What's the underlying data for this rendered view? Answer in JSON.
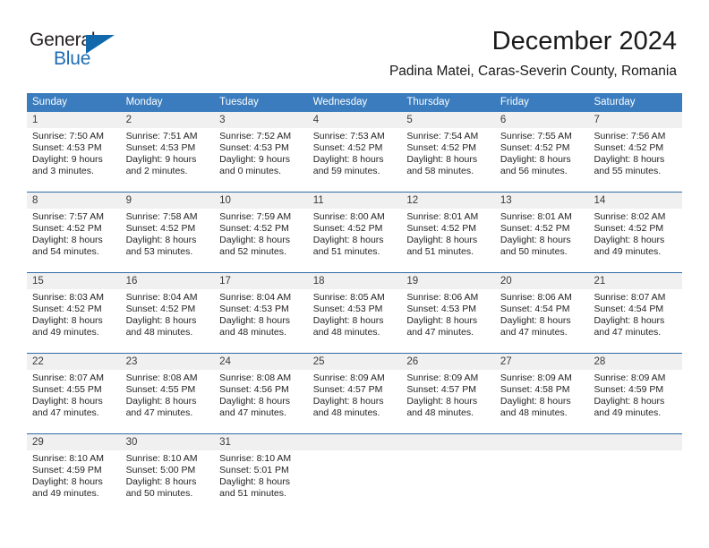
{
  "brand": {
    "name_part1": "General",
    "name_part2": "Blue",
    "flag_icon": "triangle-flag-icon"
  },
  "header": {
    "title": "December 2024",
    "subtitle": "Padina Matei, Caras-Severin County, Romania"
  },
  "weekdays": [
    "Sunday",
    "Monday",
    "Tuesday",
    "Wednesday",
    "Thursday",
    "Friday",
    "Saturday"
  ],
  "colors": {
    "header_blue": "#3a7cbe",
    "row_divider_blue": "#2f6ca6",
    "day_number_bg": "#f0f0f0",
    "brand_blue": "#1d6cb3",
    "text": "#231f20"
  },
  "weeks": [
    [
      {
        "day": "1",
        "sunrise": "Sunrise: 7:50 AM",
        "sunset": "Sunset: 4:53 PM",
        "daylight1": "Daylight: 9 hours",
        "daylight2": "and 3 minutes."
      },
      {
        "day": "2",
        "sunrise": "Sunrise: 7:51 AM",
        "sunset": "Sunset: 4:53 PM",
        "daylight1": "Daylight: 9 hours",
        "daylight2": "and 2 minutes."
      },
      {
        "day": "3",
        "sunrise": "Sunrise: 7:52 AM",
        "sunset": "Sunset: 4:53 PM",
        "daylight1": "Daylight: 9 hours",
        "daylight2": "and 0 minutes."
      },
      {
        "day": "4",
        "sunrise": "Sunrise: 7:53 AM",
        "sunset": "Sunset: 4:52 PM",
        "daylight1": "Daylight: 8 hours",
        "daylight2": "and 59 minutes."
      },
      {
        "day": "5",
        "sunrise": "Sunrise: 7:54 AM",
        "sunset": "Sunset: 4:52 PM",
        "daylight1": "Daylight: 8 hours",
        "daylight2": "and 58 minutes."
      },
      {
        "day": "6",
        "sunrise": "Sunrise: 7:55 AM",
        "sunset": "Sunset: 4:52 PM",
        "daylight1": "Daylight: 8 hours",
        "daylight2": "and 56 minutes."
      },
      {
        "day": "7",
        "sunrise": "Sunrise: 7:56 AM",
        "sunset": "Sunset: 4:52 PM",
        "daylight1": "Daylight: 8 hours",
        "daylight2": "and 55 minutes."
      }
    ],
    [
      {
        "day": "8",
        "sunrise": "Sunrise: 7:57 AM",
        "sunset": "Sunset: 4:52 PM",
        "daylight1": "Daylight: 8 hours",
        "daylight2": "and 54 minutes."
      },
      {
        "day": "9",
        "sunrise": "Sunrise: 7:58 AM",
        "sunset": "Sunset: 4:52 PM",
        "daylight1": "Daylight: 8 hours",
        "daylight2": "and 53 minutes."
      },
      {
        "day": "10",
        "sunrise": "Sunrise: 7:59 AM",
        "sunset": "Sunset: 4:52 PM",
        "daylight1": "Daylight: 8 hours",
        "daylight2": "and 52 minutes."
      },
      {
        "day": "11",
        "sunrise": "Sunrise: 8:00 AM",
        "sunset": "Sunset: 4:52 PM",
        "daylight1": "Daylight: 8 hours",
        "daylight2": "and 51 minutes."
      },
      {
        "day": "12",
        "sunrise": "Sunrise: 8:01 AM",
        "sunset": "Sunset: 4:52 PM",
        "daylight1": "Daylight: 8 hours",
        "daylight2": "and 51 minutes."
      },
      {
        "day": "13",
        "sunrise": "Sunrise: 8:01 AM",
        "sunset": "Sunset: 4:52 PM",
        "daylight1": "Daylight: 8 hours",
        "daylight2": "and 50 minutes."
      },
      {
        "day": "14",
        "sunrise": "Sunrise: 8:02 AM",
        "sunset": "Sunset: 4:52 PM",
        "daylight1": "Daylight: 8 hours",
        "daylight2": "and 49 minutes."
      }
    ],
    [
      {
        "day": "15",
        "sunrise": "Sunrise: 8:03 AM",
        "sunset": "Sunset: 4:52 PM",
        "daylight1": "Daylight: 8 hours",
        "daylight2": "and 49 minutes."
      },
      {
        "day": "16",
        "sunrise": "Sunrise: 8:04 AM",
        "sunset": "Sunset: 4:52 PM",
        "daylight1": "Daylight: 8 hours",
        "daylight2": "and 48 minutes."
      },
      {
        "day": "17",
        "sunrise": "Sunrise: 8:04 AM",
        "sunset": "Sunset: 4:53 PM",
        "daylight1": "Daylight: 8 hours",
        "daylight2": "and 48 minutes."
      },
      {
        "day": "18",
        "sunrise": "Sunrise: 8:05 AM",
        "sunset": "Sunset: 4:53 PM",
        "daylight1": "Daylight: 8 hours",
        "daylight2": "and 48 minutes."
      },
      {
        "day": "19",
        "sunrise": "Sunrise: 8:06 AM",
        "sunset": "Sunset: 4:53 PM",
        "daylight1": "Daylight: 8 hours",
        "daylight2": "and 47 minutes."
      },
      {
        "day": "20",
        "sunrise": "Sunrise: 8:06 AM",
        "sunset": "Sunset: 4:54 PM",
        "daylight1": "Daylight: 8 hours",
        "daylight2": "and 47 minutes."
      },
      {
        "day": "21",
        "sunrise": "Sunrise: 8:07 AM",
        "sunset": "Sunset: 4:54 PM",
        "daylight1": "Daylight: 8 hours",
        "daylight2": "and 47 minutes."
      }
    ],
    [
      {
        "day": "22",
        "sunrise": "Sunrise: 8:07 AM",
        "sunset": "Sunset: 4:55 PM",
        "daylight1": "Daylight: 8 hours",
        "daylight2": "and 47 minutes."
      },
      {
        "day": "23",
        "sunrise": "Sunrise: 8:08 AM",
        "sunset": "Sunset: 4:55 PM",
        "daylight1": "Daylight: 8 hours",
        "daylight2": "and 47 minutes."
      },
      {
        "day": "24",
        "sunrise": "Sunrise: 8:08 AM",
        "sunset": "Sunset: 4:56 PM",
        "daylight1": "Daylight: 8 hours",
        "daylight2": "and 47 minutes."
      },
      {
        "day": "25",
        "sunrise": "Sunrise: 8:09 AM",
        "sunset": "Sunset: 4:57 PM",
        "daylight1": "Daylight: 8 hours",
        "daylight2": "and 48 minutes."
      },
      {
        "day": "26",
        "sunrise": "Sunrise: 8:09 AM",
        "sunset": "Sunset: 4:57 PM",
        "daylight1": "Daylight: 8 hours",
        "daylight2": "and 48 minutes."
      },
      {
        "day": "27",
        "sunrise": "Sunrise: 8:09 AM",
        "sunset": "Sunset: 4:58 PM",
        "daylight1": "Daylight: 8 hours",
        "daylight2": "and 48 minutes."
      },
      {
        "day": "28",
        "sunrise": "Sunrise: 8:09 AM",
        "sunset": "Sunset: 4:59 PM",
        "daylight1": "Daylight: 8 hours",
        "daylight2": "and 49 minutes."
      }
    ],
    [
      {
        "day": "29",
        "sunrise": "Sunrise: 8:10 AM",
        "sunset": "Sunset: 4:59 PM",
        "daylight1": "Daylight: 8 hours",
        "daylight2": "and 49 minutes."
      },
      {
        "day": "30",
        "sunrise": "Sunrise: 8:10 AM",
        "sunset": "Sunset: 5:00 PM",
        "daylight1": "Daylight: 8 hours",
        "daylight2": "and 50 minutes."
      },
      {
        "day": "31",
        "sunrise": "Sunrise: 8:10 AM",
        "sunset": "Sunset: 5:01 PM",
        "daylight1": "Daylight: 8 hours",
        "daylight2": "and 51 minutes."
      },
      {
        "day": "",
        "sunrise": "",
        "sunset": "",
        "daylight1": "",
        "daylight2": ""
      },
      {
        "day": "",
        "sunrise": "",
        "sunset": "",
        "daylight1": "",
        "daylight2": ""
      },
      {
        "day": "",
        "sunrise": "",
        "sunset": "",
        "daylight1": "",
        "daylight2": ""
      },
      {
        "day": "",
        "sunrise": "",
        "sunset": "",
        "daylight1": "",
        "daylight2": ""
      }
    ]
  ]
}
